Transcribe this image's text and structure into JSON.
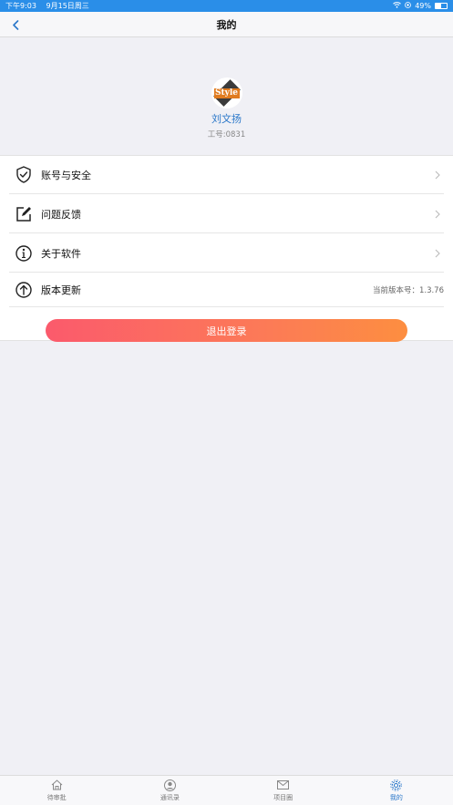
{
  "status_bar": {
    "time": "下午9:03",
    "date": "9月15日周三",
    "battery": "49%"
  },
  "nav": {
    "title": "我的"
  },
  "profile": {
    "avatar_text": "Style",
    "name": "刘文扬",
    "employee_id": "工号:0831"
  },
  "menu": {
    "items": [
      {
        "label": "账号与安全",
        "icon": "shield-check-icon"
      },
      {
        "label": "问题反馈",
        "icon": "edit-icon"
      },
      {
        "label": "关于软件",
        "icon": "info-icon"
      },
      {
        "label": "版本更新",
        "icon": "arrow-up-circle-icon",
        "value": "当前版本号：1.3.76"
      }
    ]
  },
  "logout_label": "退出登录",
  "tabs": [
    {
      "label": "待审批",
      "icon": "home-icon"
    },
    {
      "label": "通讯录",
      "icon": "person-icon"
    },
    {
      "label": "项目圈",
      "icon": "mail-icon"
    },
    {
      "label": "我的",
      "icon": "gear-icon",
      "active": true
    }
  ],
  "colors": {
    "status_bar": "#2a8ee8",
    "accent": "#2a77c9",
    "logout_gradient_start": "#fb5a6c",
    "logout_gradient_end": "#fd8e40"
  }
}
